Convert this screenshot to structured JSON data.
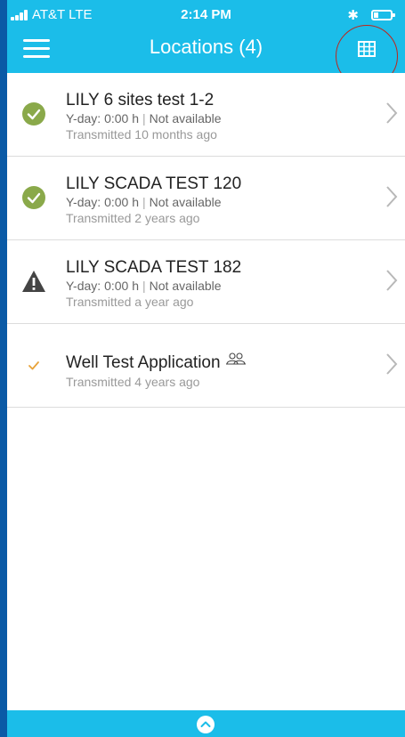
{
  "status_bar": {
    "carrier": "AT&T  LTE",
    "time": "2:14 PM",
    "bluetooth": "✱"
  },
  "header": {
    "title": "Locations (4)",
    "menu_icon": "hamburger-menu-icon",
    "grid_icon": "grid-view-icon"
  },
  "locations": [
    {
      "name": "LILY 6 sites test 1-2",
      "yday": "Y-day:  0:00 h",
      "availability": "Not available",
      "transmitted": "Transmitted 10 months ago",
      "status_icon": "check-circle-icon"
    },
    {
      "name": "LILY SCADA TEST 120",
      "yday": "Y-day:  0:00 h",
      "availability": "Not available",
      "transmitted": "Transmitted 2 years ago",
      "status_icon": "check-circle-icon"
    },
    {
      "name": "LILY SCADA TEST 182",
      "yday": "Y-day:  0:00 h",
      "availability": "Not available",
      "transmitted": "Transmitted a year ago",
      "status_icon": "warning-triangle-icon"
    },
    {
      "name": "Well Test Application",
      "transmitted": "Transmitted 4 years ago",
      "status_icon": "checkmark-icon",
      "extra_icon": "group-icon"
    }
  ],
  "colors": {
    "header": "#1bbde9",
    "outer_background": "#0a5aa6",
    "ok_green": "#8aa94a",
    "warning_dark": "#444444",
    "check_orange": "#e8a33a",
    "annotation_red": "#c0241a"
  },
  "footer": {
    "expand_icon": "chevron-up-circle-icon"
  }
}
